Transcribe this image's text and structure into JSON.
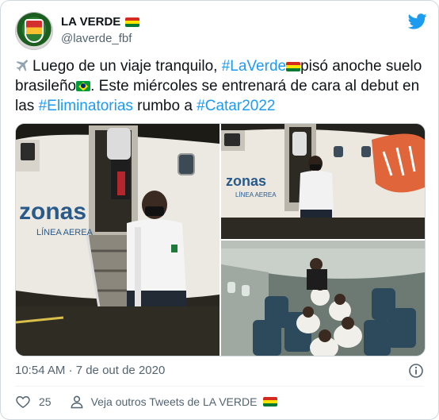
{
  "user": {
    "display_name": "LA VERDE",
    "handle": "@laverde_fbf",
    "flag_icon": "bolivia-flag-icon",
    "verified_icon": "none"
  },
  "tweet": {
    "parts": [
      {
        "type": "text",
        "value": "Luego de un viaje tranquilo, "
      },
      {
        "type": "hashtag",
        "value": "#LaVerde"
      },
      {
        "type": "text",
        "value": "pisó anoche suelo brasileño"
      },
      {
        "type": "text",
        "value": ". Este miércoles se entrenará de cara al debut en las "
      },
      {
        "type": "hashtag",
        "value": "#Eliminatorias"
      },
      {
        "type": "text",
        "value": " rumbo a "
      },
      {
        "type": "hashtag",
        "value": "#Catar2022"
      }
    ],
    "timestamp": "10:54 AM · 7 de out de 2020",
    "likes": "25",
    "more_tweets_label": "Veja outros Tweets de LA VERDE"
  },
  "media": {
    "photo1_airline": "zonas",
    "photo1_airline_sub": "LÍNEA AEREA",
    "photo2_airline": "zonas",
    "photo2_airline_sub": "LÍNEA AEREA"
  },
  "colors": {
    "accent": "#1d9bf0",
    "muted": "#536471",
    "border": "#cfd9de"
  }
}
